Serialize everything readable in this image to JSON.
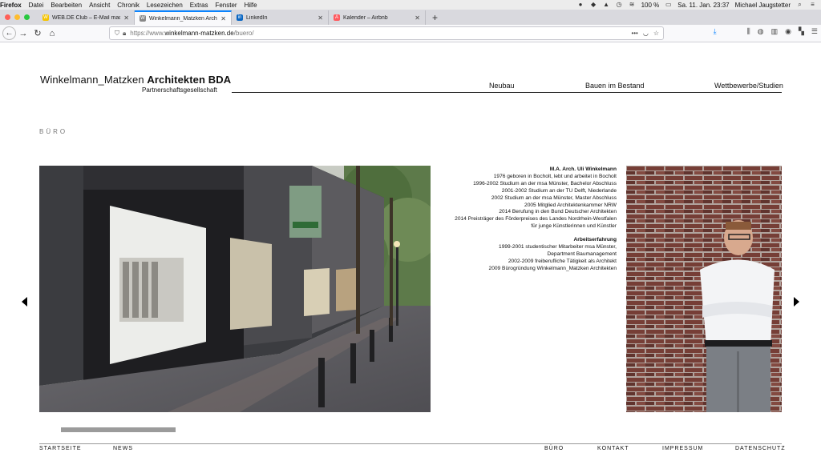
{
  "menubar": {
    "app": "Firefox",
    "items": [
      "Datei",
      "Bearbeiten",
      "Ansicht",
      "Chronik",
      "Lesezeichen",
      "Extras",
      "Fenster",
      "Hilfe"
    ],
    "battery": "100 %",
    "datetime": "Sa. 11. Jan.  23:37",
    "user": "Michael Jaugstetter"
  },
  "tabs": [
    {
      "title": "WEB.DE Club – E-Mail made in Germ",
      "fav_color": "#f5c400",
      "fav_text": "W"
    },
    {
      "title": "Winkelmann_Matzken Architekten",
      "fav_color": "#888888",
      "fav_text": "W"
    },
    {
      "title": "LinkedIn",
      "fav_color": "#0a66c2",
      "fav_text": "in"
    },
    {
      "title": "Kalender – Airbnb",
      "fav_color": "#ff5a5f",
      "fav_text": "A"
    }
  ],
  "urlbar": {
    "prefix": "https://www.",
    "domain": "winkelmann-matzken.de",
    "path": "/buero/"
  },
  "site": {
    "logo_name": "Winkelmann_Matzken",
    "logo_bold": "Architekten BDA",
    "logo_sub": "Partnerschaftsgesellschaft",
    "nav": [
      "Neubau",
      "Bauen im Bestand",
      "Wettbewerbe/Studien"
    ],
    "section": "BÜRO"
  },
  "bio": {
    "heading": "M.A. Arch. Uli Winkelmann",
    "lines": [
      "1976 geboren in Bocholt, lebt und arbeitet in Bocholt",
      "1996-2002 Studium an der msa Münster, Bachelor Abschluss",
      "2001-2002 Studium an der TU Delft, Niederlande",
      "2002 Studium an der msa Münster, Master Abschluss",
      "2005 Mitglied Architektenkammer NRW",
      "2014 Berufung in den Bund Deutscher Architekten",
      "2014 Preisträger des Förderpreises des Landes Nordrhein-Westfalen",
      "für junge Künstlerinnen und Künstler"
    ],
    "heading2": "Arbeitserfahrung",
    "lines2": [
      "1999-2001 studentischer Mitarbeiter msa Münster,",
      "Department Baumanagement",
      "2002-2009 freiberufliche Tätigkeit als Architekt",
      "2009 Bürogründung Winkelmann_Matzken Architekten"
    ]
  },
  "footer": {
    "left": [
      "STARTSEITE",
      "NEWS"
    ],
    "right": [
      "BÜRO",
      "KONTAKT",
      "IMPRESSUM",
      "DATENSCHUTZ"
    ]
  }
}
